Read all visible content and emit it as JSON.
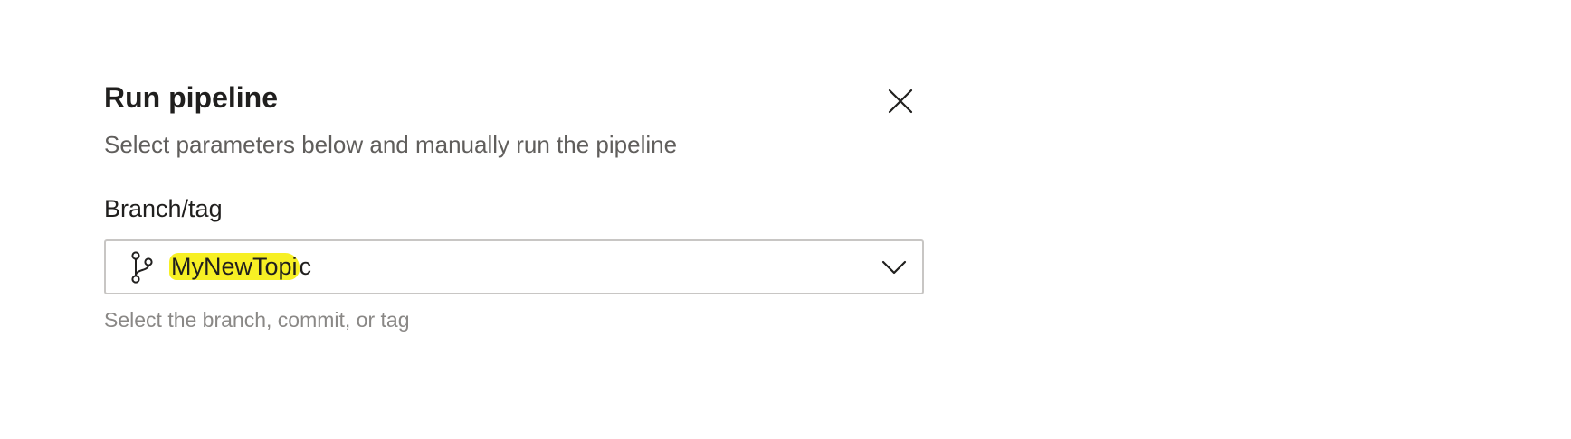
{
  "dialog": {
    "title": "Run pipeline",
    "subtitle": "Select parameters below and manually run the pipeline",
    "close_icon": "close-icon"
  },
  "branch_field": {
    "label": "Branch/tag",
    "icon": "branch-icon",
    "value_highlighted": "MyNewTopi",
    "value_rest": "c",
    "dropdown_icon": "chevron-down-icon",
    "helper_text": "Select the branch, commit, or tag"
  },
  "colors": {
    "highlight": "#f7f024",
    "border": "#c8c6c4",
    "text_primary": "#201f1e",
    "text_secondary": "#605e5c"
  }
}
